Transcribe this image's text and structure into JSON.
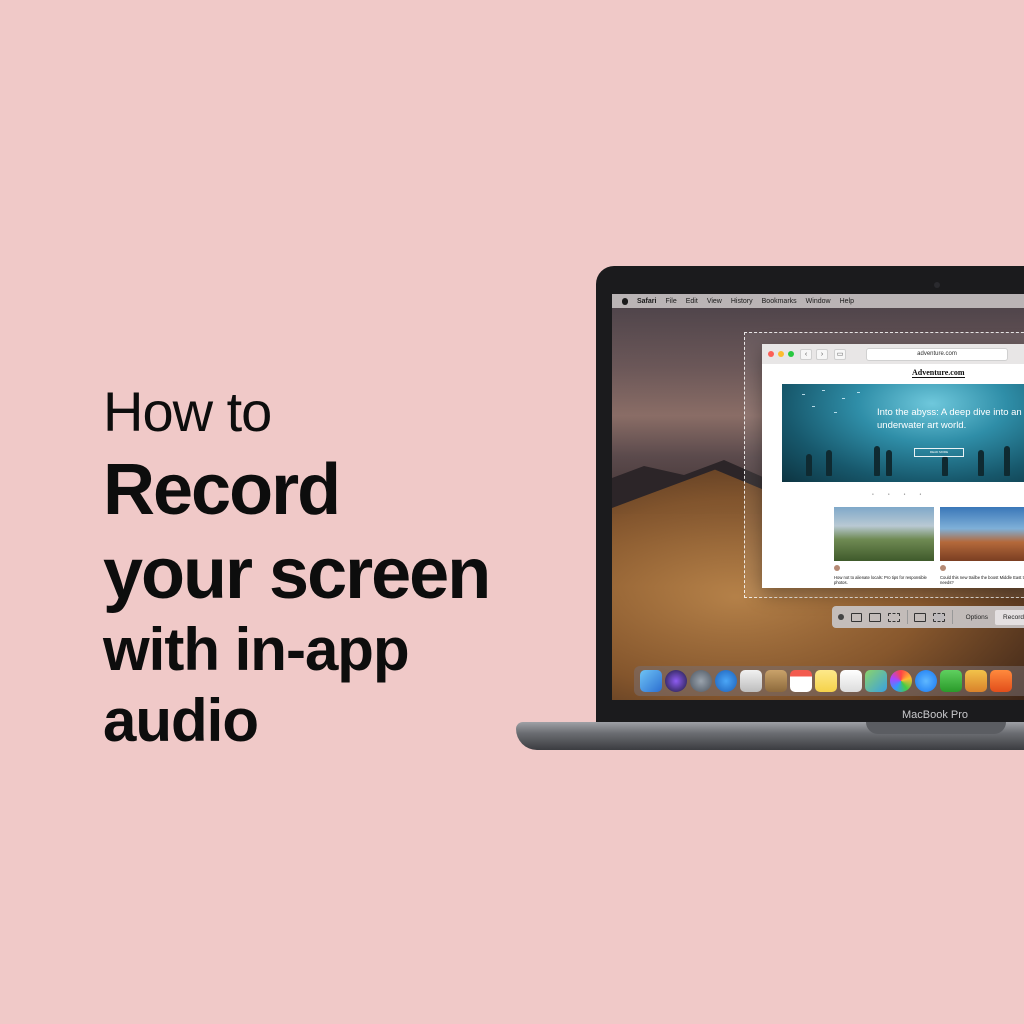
{
  "headline": {
    "line1": "How to",
    "line2": "Record",
    "line3": "your screen",
    "line4": "with in-app",
    "line5": "audio"
  },
  "laptop": {
    "brand": "MacBook Pro"
  },
  "menubar": {
    "app_name": "Safari",
    "items": [
      "File",
      "Edit",
      "View",
      "History",
      "Bookmarks",
      "Window",
      "Help"
    ]
  },
  "browser": {
    "url": "adventure.com",
    "site_logo": "Adventure.com",
    "hero_title": "Into the abyss: A deep dive into an underwater art world.",
    "hero_button": "READ MORE",
    "cards": [
      {
        "title": "How not to alienate locals: Pro tips for responsible photos."
      },
      {
        "title": "Could this new trailbe the boost Middle East tourism needs?"
      }
    ]
  },
  "capture_bar": {
    "options_label": "Options",
    "record_label": "Record"
  },
  "colors": {
    "background": "#f0c9c8",
    "text": "#0d0d0d",
    "laptop_bezel": "#1b1b1d"
  }
}
